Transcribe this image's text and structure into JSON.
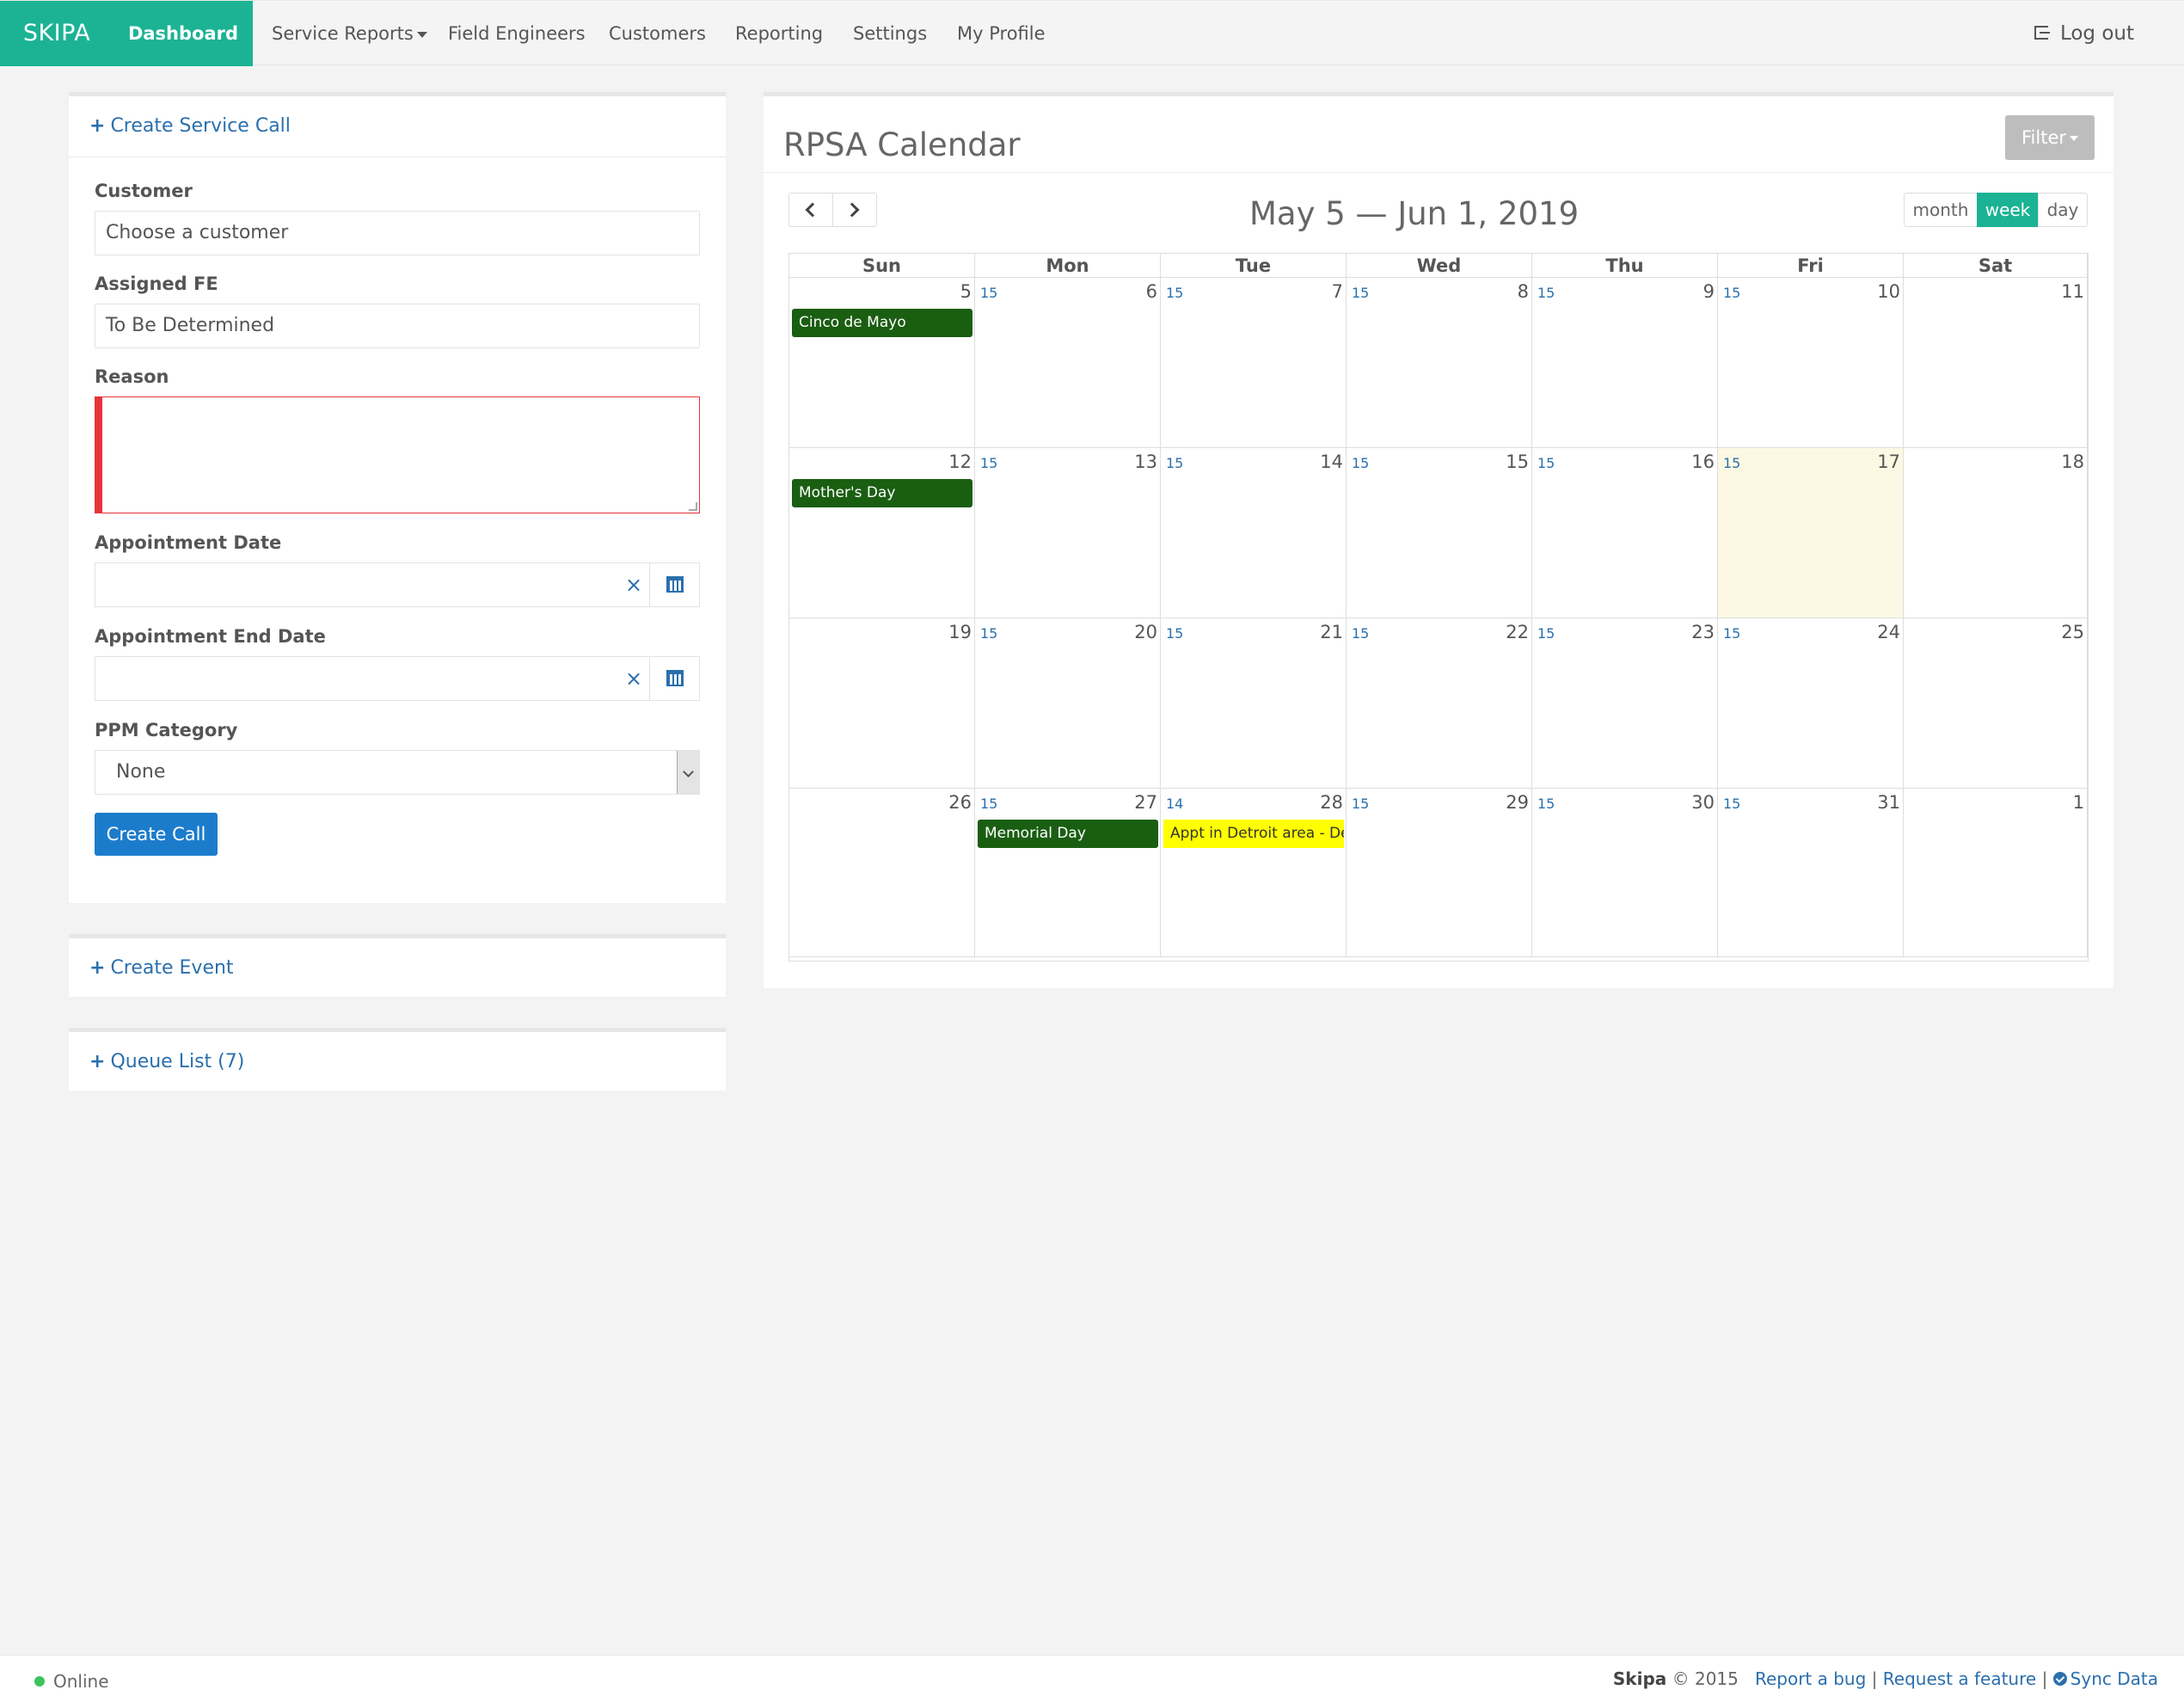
{
  "nav": {
    "brand": "SKIPA",
    "items": [
      {
        "label": "Dashboard",
        "active": true
      },
      {
        "label": "Service Reports",
        "dropdown": true
      },
      {
        "label": "Field Engineers"
      },
      {
        "label": "Customers"
      },
      {
        "label": "Reporting"
      },
      {
        "label": "Settings"
      },
      {
        "label": "My Profile"
      }
    ],
    "logout": "Log out"
  },
  "service_call": {
    "header": "Create Service Call",
    "customer_label": "Customer",
    "customer_placeholder": "Choose a customer",
    "fe_label": "Assigned FE",
    "fe_value": "To Be Determined",
    "reason_label": "Reason",
    "appt_date_label": "Appointment Date",
    "appt_end_label": "Appointment End Date",
    "ppm_label": "PPM Category",
    "ppm_value": "None",
    "submit": "Create Call",
    "clear_glyph": "×"
  },
  "event_panel": {
    "header": "Create Event"
  },
  "queue_panel": {
    "header": "Queue List (7)"
  },
  "calendar": {
    "title": "RPSA Calendar",
    "filter": "Filter",
    "range": "May 5 — Jun 1, 2019",
    "views": [
      "month",
      "week",
      "day"
    ],
    "active_view": "week",
    "weekdays": [
      "Sun",
      "Mon",
      "Tue",
      "Wed",
      "Thu",
      "Fri",
      "Sat"
    ],
    "weeks": [
      {
        "days": [
          "5",
          "6",
          "7",
          "8",
          "9",
          "10",
          "11"
        ],
        "counts": [
          "15",
          "15",
          "15",
          "15",
          "15",
          "",
          ""
        ]
      },
      {
        "days": [
          "12",
          "13",
          "14",
          "15",
          "16",
          "17",
          "18"
        ],
        "counts": [
          "15",
          "15",
          "15",
          "15",
          "15",
          "",
          ""
        ],
        "today": 5
      },
      {
        "days": [
          "19",
          "20",
          "21",
          "22",
          "23",
          "24",
          "25"
        ],
        "counts": [
          "15",
          "15",
          "15",
          "15",
          "15",
          "",
          ""
        ]
      },
      {
        "days": [
          "26",
          "27",
          "28",
          "29",
          "30",
          "31",
          "1"
        ],
        "counts": [
          "15",
          "14",
          "15",
          "15",
          "15",
          "",
          ""
        ]
      }
    ],
    "events": [
      {
        "title": "Cinco de Mayo",
        "week": 0,
        "day": 0,
        "color": "#1a5e12"
      },
      {
        "title": "Mother's Day",
        "week": 1,
        "day": 0,
        "color": "#1a5e12"
      },
      {
        "title": "Memorial Day",
        "week": 3,
        "day": 1,
        "color": "#1a5e12"
      },
      {
        "title": "Appt in Detroit area - Dev",
        "week": 3,
        "day": 2,
        "color": "#ffff00"
      }
    ]
  },
  "footer": {
    "status": "Online",
    "brand": "Skipa",
    "copyright": "© 2015",
    "report_bug": "Report a bug",
    "sep1": "|",
    "request_feature": "Request a feature",
    "sep2": "|",
    "sync": "Sync Data"
  }
}
